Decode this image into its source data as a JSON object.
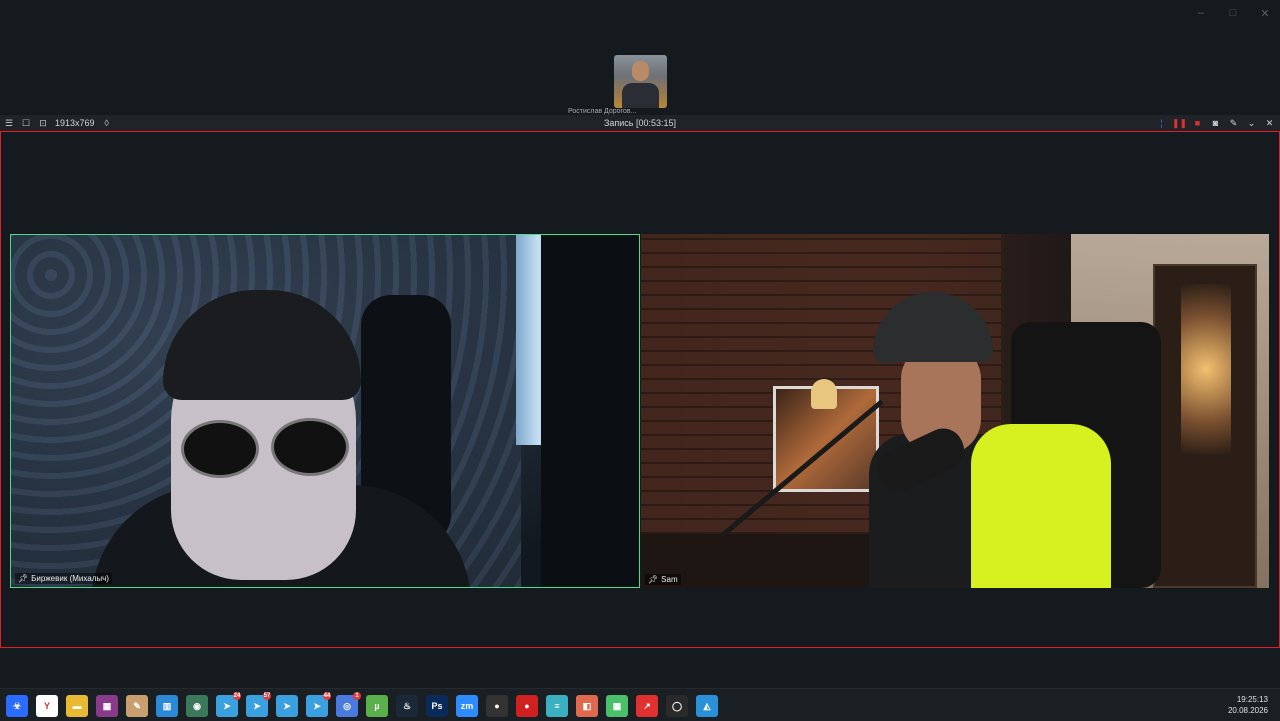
{
  "window_controls": {
    "minimize": "–",
    "maximize": "□",
    "close": "✕"
  },
  "thumbnail": {
    "label": "Ростислав Дорогов..."
  },
  "recorder": {
    "resolution": "1913x769",
    "title": "Запись [00:53:15]"
  },
  "participants": [
    {
      "name": "Биржевик (Михалыч)"
    },
    {
      "name": "Sam"
    }
  ],
  "taskbar": {
    "apps": [
      {
        "icon": "biohazard-icon",
        "glyph": "☣",
        "color": "#2a6cff",
        "badge": ""
      },
      {
        "icon": "yandex-browser-icon",
        "glyph": "Y",
        "color": "#ffffff",
        "badge": ""
      },
      {
        "icon": "folder-icon",
        "glyph": "▬",
        "color": "#e8b933",
        "badge": ""
      },
      {
        "icon": "winrar-icon",
        "glyph": "▦",
        "color": "#8a3a8a",
        "badge": ""
      },
      {
        "icon": "pen-icon",
        "glyph": "✎",
        "color": "#c8a070",
        "badge": ""
      },
      {
        "icon": "store-icon",
        "glyph": "▥",
        "color": "#2a8ad8",
        "badge": ""
      },
      {
        "icon": "globe-icon",
        "glyph": "◉",
        "color": "#3a7a5a",
        "badge": ""
      },
      {
        "icon": "telegram-icon",
        "glyph": "➤",
        "color": "#3aa0e0",
        "badge": "24"
      },
      {
        "icon": "telegram-icon",
        "glyph": "➤",
        "color": "#3aa0e0",
        "badge": "57"
      },
      {
        "icon": "telegram-icon",
        "glyph": "➤",
        "color": "#3aa0e0",
        "badge": ""
      },
      {
        "icon": "telegram-icon",
        "glyph": "➤",
        "color": "#3aa0e0",
        "badge": "44"
      },
      {
        "icon": "chrome-icon",
        "glyph": "◎",
        "color": "#4a7ae0",
        "badge": "1"
      },
      {
        "icon": "utorrent-icon",
        "glyph": "µ",
        "color": "#5ab04a",
        "badge": ""
      },
      {
        "icon": "steam-icon",
        "glyph": "♨",
        "color": "#1b2838",
        "badge": ""
      },
      {
        "icon": "photoshop-icon",
        "glyph": "Ps",
        "color": "#0a2a5a",
        "badge": ""
      },
      {
        "icon": "zoom-icon",
        "glyph": "zm",
        "color": "#2d8cff",
        "badge": ""
      },
      {
        "icon": "obs-icon",
        "glyph": "●",
        "color": "#333333",
        "badge": ""
      },
      {
        "icon": "record-icon",
        "glyph": "●",
        "color": "#d02020",
        "badge": ""
      },
      {
        "icon": "notes-icon",
        "glyph": "≡",
        "color": "#3ab0c0",
        "badge": ""
      },
      {
        "icon": "app-icon",
        "glyph": "◧",
        "color": "#e06a50",
        "badge": ""
      },
      {
        "icon": "table-icon",
        "glyph": "▦",
        "color": "#4ac06a",
        "badge": ""
      },
      {
        "icon": "arrow-icon",
        "glyph": "↗",
        "color": "#e03030",
        "badge": ""
      },
      {
        "icon": "github-icon",
        "glyph": "◯",
        "color": "#2a2a2a",
        "badge": ""
      },
      {
        "icon": "paint-icon",
        "glyph": "◭",
        "color": "#2a90d8",
        "badge": ""
      }
    ],
    "time": "19:25:13",
    "date": "20.08.2026"
  }
}
